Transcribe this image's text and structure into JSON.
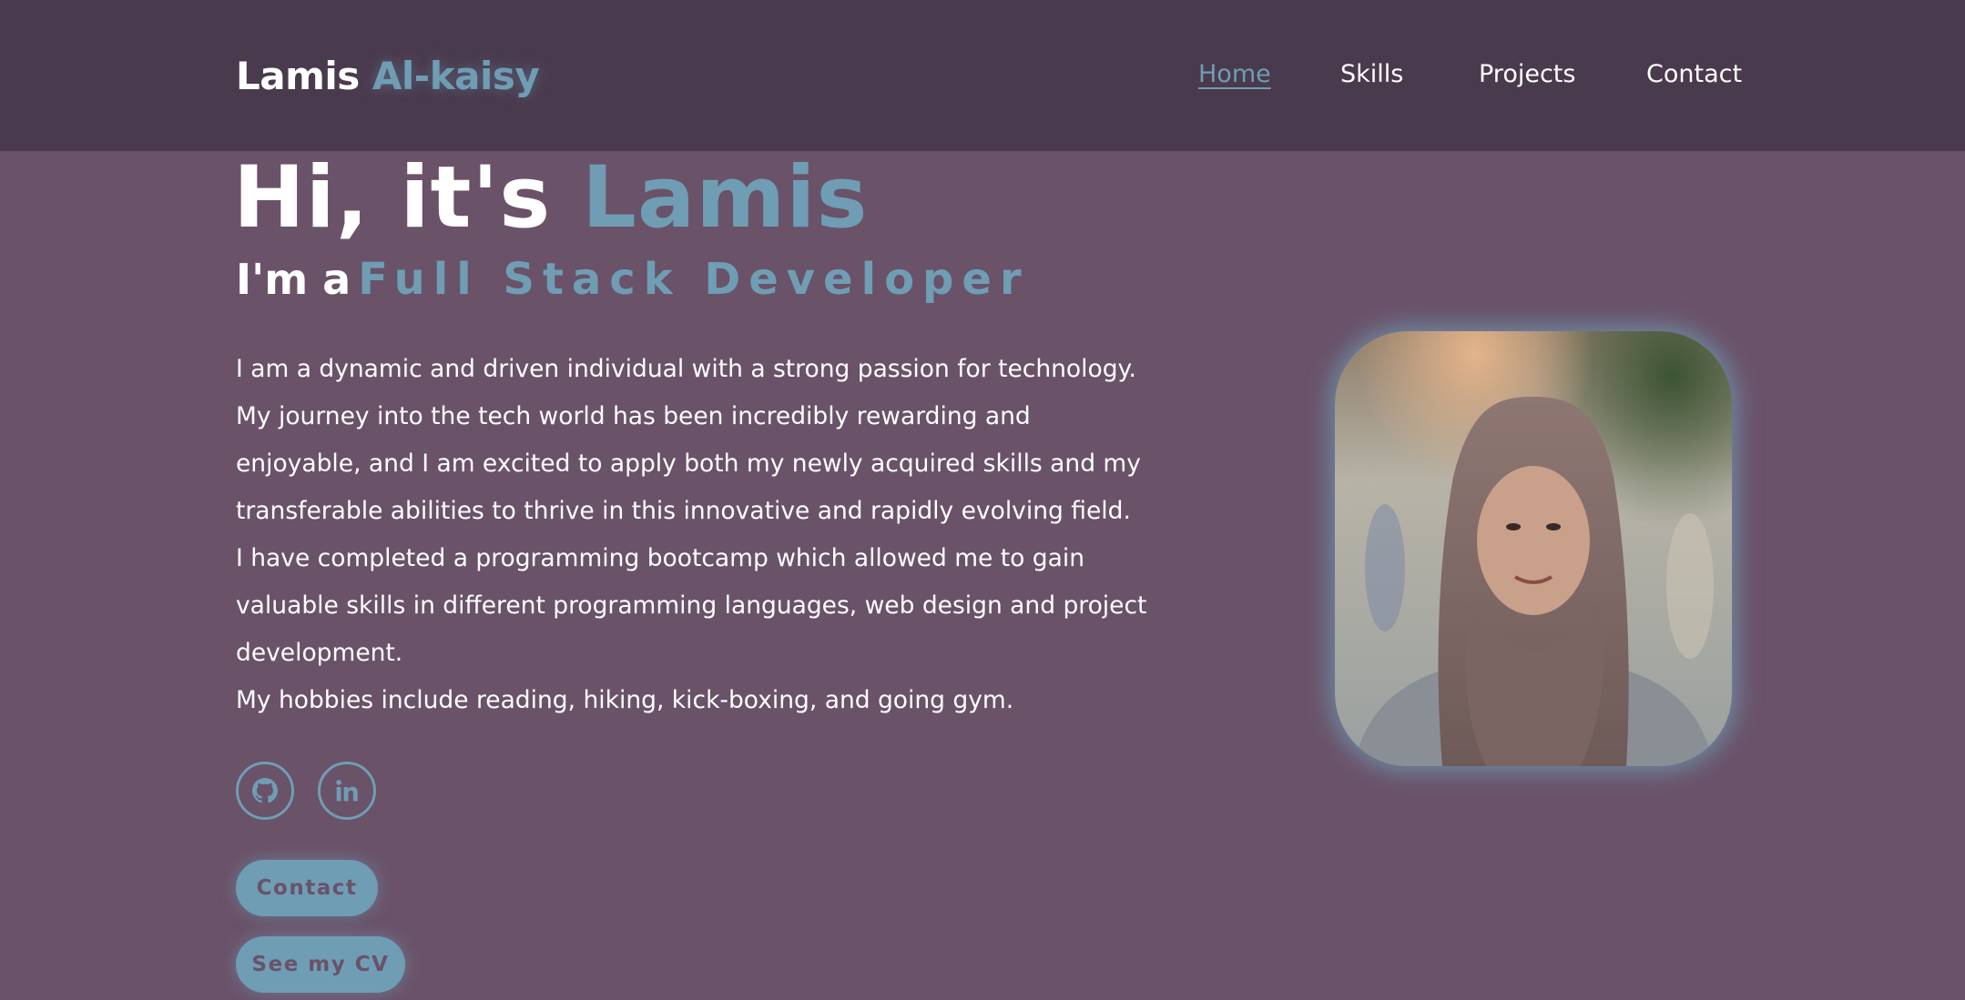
{
  "header": {
    "logo_first": "Lamis",
    "logo_last": "Al-kaisy",
    "nav": [
      {
        "label": "Home",
        "active": true
      },
      {
        "label": "Skills",
        "active": false
      },
      {
        "label": "Projects",
        "active": false
      },
      {
        "label": "Contact",
        "active": false
      }
    ]
  },
  "hero": {
    "greeting": "Hi, it's",
    "name": "Lamis",
    "im_prefix": "I'm a",
    "role": "Full Stack Developer",
    "about": [
      "I am a dynamic and driven individual with a strong passion for technology. My journey into the tech world has been incredibly rewarding and enjoyable, and I am excited to apply both my newly acquired skills and my transferable abilities to thrive in this innovative and rapidly evolving field.",
      "I have completed a programming bootcamp which allowed me to gain valuable skills in different programming languages, web design and project development.",
      "My hobbies include reading, hiking, kick-boxing, and going gym."
    ]
  },
  "socials": [
    {
      "icon": "github-icon"
    },
    {
      "icon": "linkedin-icon"
    }
  ],
  "buttons": {
    "contact": "Contact",
    "cv": "See my CV"
  },
  "colors": {
    "background": "#6a5269",
    "header": "#4a3a4d",
    "accent": "#6f9db4",
    "text": "#ffffff"
  }
}
